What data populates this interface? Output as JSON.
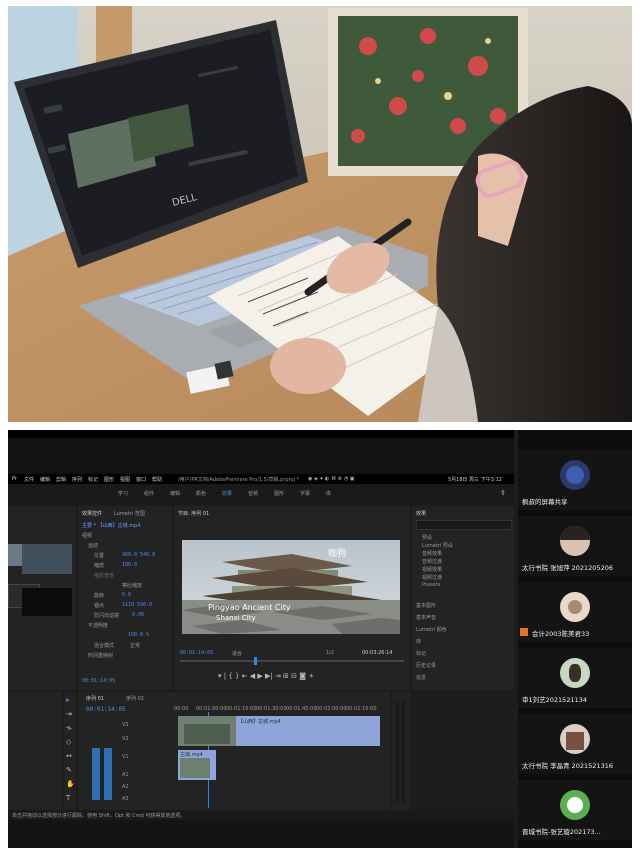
{
  "menubar": {
    "items": [
      "Pr",
      "文件",
      "编辑",
      "剪辑",
      "序列",
      "标记",
      "图形",
      "视图",
      "窗口",
      "帮助"
    ],
    "title": "/用户/PR文档/AdobePremiere Pro/1.5/草稿.prproj *",
    "clock": "5月18日 周三 下午3:12",
    "workspaces": [
      "学习",
      "组件",
      "编辑",
      "颜色",
      "效果",
      "音频",
      "图形",
      "字幕",
      "库"
    ]
  },
  "effect_controls": {
    "tabs": [
      "效果控件",
      "Lumetri 范围"
    ],
    "clip_label": "主要 * 【山西】古城.mp4",
    "section_video": "视频",
    "motion": "运动",
    "props": [
      {
        "name": "位置",
        "value": "960.0   540.0"
      },
      {
        "name": "缩放",
        "value": "100.0"
      },
      {
        "name": "缩放宽度",
        "value": ""
      },
      {
        "name": "等比缩放",
        "value": ""
      },
      {
        "name": "旋转",
        "value": "0.0"
      },
      {
        "name": "锚点",
        "value": "1110    590.0"
      },
      {
        "name": "防闪烁滤镜",
        "value": "0.00"
      }
    ],
    "opacity": "不透明度",
    "opacity_value": "100.0 %",
    "blend_label": "混合模式",
    "blend_value": "正常",
    "time_remap": "时间重映射",
    "timecode": "00:01:14:05"
  },
  "program": {
    "tab": "节目: 序列 01",
    "watermark": "咖狗",
    "caption_line1": "Pingyao Ancient City",
    "caption_line2": "Shanxi City",
    "timecode_left": "00:01:14:05",
    "fit": "适合",
    "quality": "1/2",
    "timecode_right": "00:03:26:14"
  },
  "effects_panel": {
    "tab": "效果",
    "search_placeholder": "",
    "folders": [
      "预设",
      "Lumetri 预设",
      "音频效果",
      "音频过渡",
      "视频效果",
      "视频过渡",
      "Presets"
    ],
    "sections": [
      "基本图形",
      "基本声音",
      "Lumetri 颜色",
      "库",
      "标记",
      "历史记录",
      "信息"
    ]
  },
  "timeline": {
    "tabs": [
      "序列 01",
      "序列 02"
    ],
    "timecode": "00:01:14:05",
    "ruler": [
      "00:00",
      "00:01:00:00",
      "00:01:15:00",
      "00:01:30:00",
      "00:01:45:00",
      "00:02:00:00",
      "00:02:15:00"
    ],
    "tracks": [
      "V3",
      "V2",
      "V1",
      "A1",
      "A2",
      "A3"
    ],
    "clip_v2": "【山西】古城.mp4",
    "clip_v1": "古城.mp4"
  },
  "status_bar": "单击并拖动以选择部分进行跟踪。使用 Shift、Opt 和 Cmd 可获得其他选项。",
  "participants": [
    {
      "name": "枫叔的屏幕共享",
      "avatar_color": "#2a3a6a"
    },
    {
      "name": "太行书院 张旭萍 2021205206",
      "avatar_color": "#d9c2b0"
    },
    {
      "name": "会计2003陈美君33",
      "avatar_color": "#e8d8c8"
    },
    {
      "name": "审1刘艺2021521134",
      "avatar_color": "#c8d8c0"
    },
    {
      "name": "太行书院 李晶青 2021521316",
      "avatar_color": "#dad0c6"
    },
    {
      "name": "晋城书院-张艺璇202173...",
      "avatar_color": "#58b050"
    }
  ],
  "colors": {
    "accent_blue": "#2d8ceb",
    "clip_video": "#8fa5d9",
    "clip_audio": "#3a78c0",
    "panel": "#232323"
  }
}
